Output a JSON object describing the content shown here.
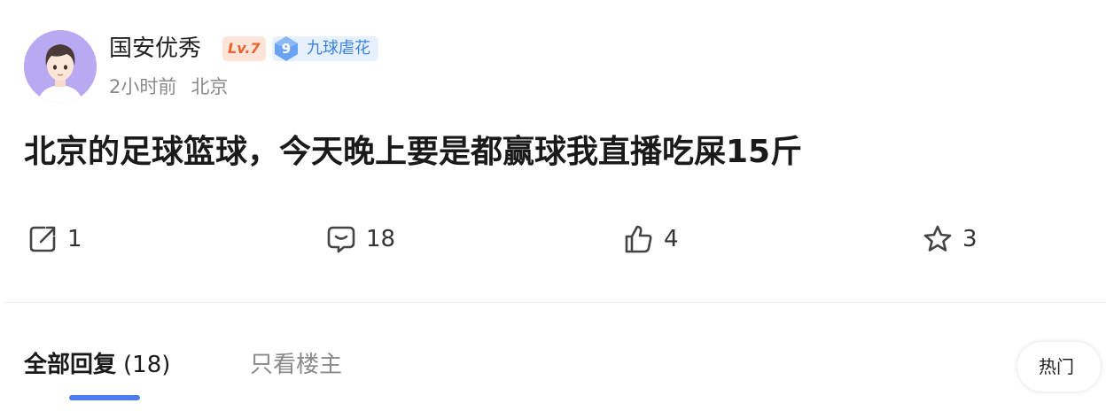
{
  "user": {
    "name": "国安优秀",
    "level_badge": "Lv.7",
    "fan_badge": {
      "level": "9",
      "name": "九球虐花"
    },
    "time": "2小时前",
    "location": "北京"
  },
  "post": {
    "text": "北京的足球篮球，今天晚上要是都赢球我直播吃屎15斤"
  },
  "actions": {
    "share": {
      "icon": "share-icon",
      "count": "1"
    },
    "comment": {
      "icon": "comment-icon",
      "count": "18"
    },
    "like": {
      "icon": "thumbs-up-icon",
      "count": "4"
    },
    "favorite": {
      "icon": "star-icon",
      "count": "3"
    }
  },
  "tabs": {
    "all_replies": {
      "label": "全部回复",
      "count": "(18)"
    },
    "owner_only": {
      "label": "只看楼主"
    },
    "sort_button": "热门"
  },
  "colors": {
    "accent_blue": "#4b7cf0",
    "level_badge_bg": "#fde4d8",
    "level_badge_text": "#e8632d",
    "fan_badge_bg": "#e7f0fd",
    "fan_badge_text": "#3b82e8",
    "avatar_bg": "#b9a8f2",
    "muted_text": "#8a8a8a"
  }
}
